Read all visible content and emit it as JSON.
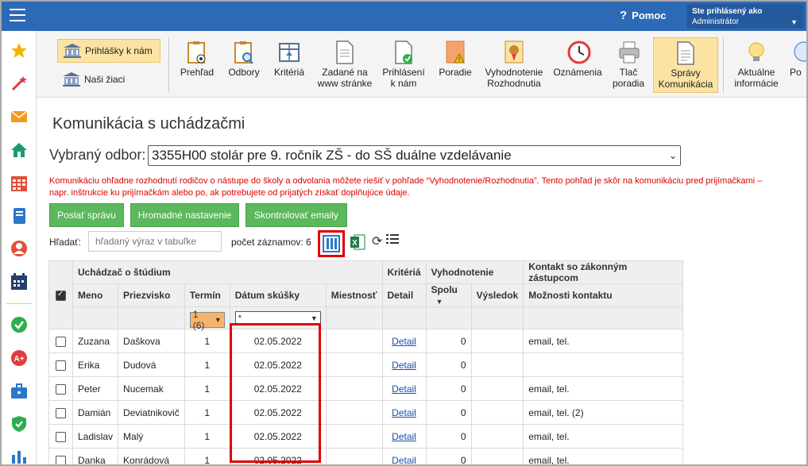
{
  "topbar": {
    "help_label": "Pomoc",
    "user_caption": "Ste prihlásený ako",
    "user_name": "Administrátor"
  },
  "toolbar": {
    "left_buttons": [
      "Prihlášky k nám",
      "Naši žiaci"
    ],
    "items": [
      "Prehľad",
      "Odbory",
      "Kritériá",
      "Zadané na www stránke",
      "Prihlásení k nám",
      "Poradie",
      "Vyhodnotenie Rozhodnutia",
      "Oznámenia",
      "Tlač poradia",
      "Správy Komunikácia",
      "Aktuálne informácie",
      "Po"
    ]
  },
  "page": {
    "title": "Komunikácia s uchádzačmi",
    "odbor_label": "Vybraný odbor:",
    "odbor_value": "3355H00 stolár pre 9. ročník ZŠ - do SŠ duálne vzdelávanie",
    "notice": "Komunikáciu ohľadne rozhodnutí rodičov o nástupe do školy a odvolania môžete riešiť v pohľade “Vyhodnotenie/Rozhodnutia”. Tento pohľad je skôr na komunikáciu pred prijímačkami – napr. inštrukcie ku prijímačkám alebo po, ak potrebujete od prijatých získať doplňujúce údaje.",
    "buttons": {
      "send": "Poslať správu",
      "bulk": "Hromadné nastavenie",
      "check": "Skontrolovať emaily"
    },
    "search_label": "Hľadať:",
    "search_placeholder": "hľadaný výraz v tabuľke",
    "count_label": "počet záznamov: 6"
  },
  "table": {
    "group_headers": [
      "Uchádzač o štúdium",
      "Kritériá",
      "Vyhodnotenie",
      "Kontakt so zákonným zástupcom"
    ],
    "columns": [
      "Meno",
      "Priezvisko",
      "Termín",
      "Dátum skúšky",
      "Miestnosť",
      "Detail",
      "Spolu",
      "Výsledok",
      "Možnosti kontaktu"
    ],
    "termin_filter": "1 (6)",
    "datum_filter": "*",
    "sort_indicator": "▼",
    "rows": [
      {
        "meno": "Zuzana",
        "priezvisko": "Daškova",
        "termin": "1",
        "datum": "02.05.2022",
        "miestnost": "",
        "detail": "Detail",
        "spolu": "0",
        "vysledok": "",
        "kontakt": "email, tel."
      },
      {
        "meno": "Erika",
        "priezvisko": "Dudová",
        "termin": "1",
        "datum": "02.05.2022",
        "miestnost": "",
        "detail": "Detail",
        "spolu": "0",
        "vysledok": "",
        "kontakt": ""
      },
      {
        "meno": "Peter",
        "priezvisko": "Nucemak",
        "termin": "1",
        "datum": "02.05.2022",
        "miestnost": "",
        "detail": "Detail",
        "spolu": "0",
        "vysledok": "",
        "kontakt": "email, tel."
      },
      {
        "meno": "Damián",
        "priezvisko": "Deviatnikovič",
        "termin": "1",
        "datum": "02.05.2022",
        "miestnost": "",
        "detail": "Detail",
        "spolu": "0",
        "vysledok": "",
        "kontakt": "email, tel. (2)"
      },
      {
        "meno": "Ladislav",
        "priezvisko": "Malý",
        "termin": "1",
        "datum": "02.05.2022",
        "miestnost": "",
        "detail": "Detail",
        "spolu": "0",
        "vysledok": "",
        "kontakt": "email, tel."
      },
      {
        "meno": "Danka",
        "priezvisko": "Konrádová",
        "termin": "1",
        "datum": "02.05.2022",
        "miestnost": "",
        "detail": "Detail",
        "spolu": "0",
        "vysledok": "",
        "kontakt": "email, tel."
      }
    ]
  },
  "colors": {
    "topbar": "#2d6ab5",
    "green_button": "#5cb85c",
    "highlight": "#e00000",
    "active_tab": "#fbe3a3"
  }
}
